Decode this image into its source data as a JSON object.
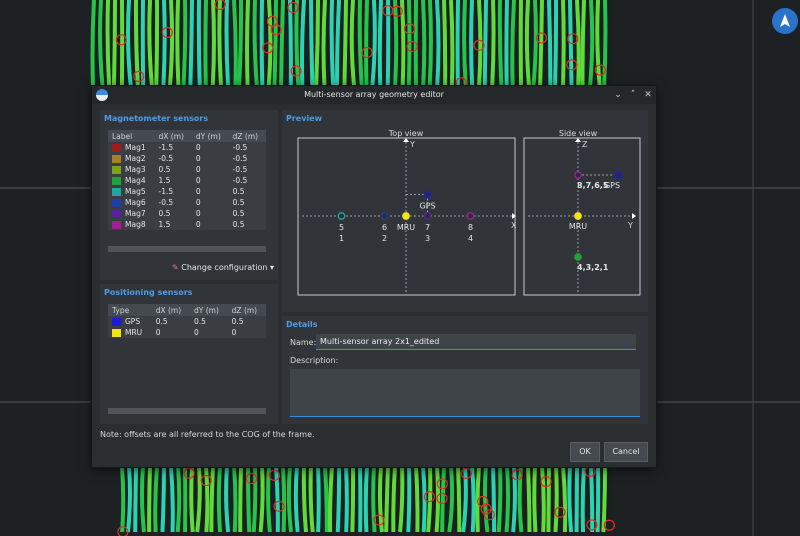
{
  "dialog": {
    "title": "Multi-sensor array geometry editor",
    "controls": [
      "⌄",
      "˄",
      "✕"
    ]
  },
  "magnetometer": {
    "title": "Magnetometer sensors",
    "columns": [
      "Label",
      "dX (m)",
      "dY (m)",
      "dZ (m)"
    ],
    "rows": [
      {
        "label": "Mag1",
        "color": "#a01a1a",
        "dx": "-1.5",
        "dy": "0",
        "dz": "-0.5"
      },
      {
        "label": "Mag2",
        "color": "#a8821e",
        "dx": "-0.5",
        "dy": "0",
        "dz": "-0.5"
      },
      {
        "label": "Mag3",
        "color": "#7ca21e",
        "dx": "0.5",
        "dy": "0",
        "dz": "-0.5"
      },
      {
        "label": "Mag4",
        "color": "#22a03a",
        "dx": "1.5",
        "dy": "0",
        "dz": "-0.5"
      },
      {
        "label": "Mag5",
        "color": "#1fa8a0",
        "dx": "-1.5",
        "dy": "0",
        "dz": "0.5"
      },
      {
        "label": "Mag6",
        "color": "#1f3fa8",
        "dx": "-0.5",
        "dy": "0",
        "dz": "0.5"
      },
      {
        "label": "Mag7",
        "color": "#5a1fa8",
        "dx": "0.5",
        "dy": "0",
        "dz": "0.5"
      },
      {
        "label": "Mag8",
        "color": "#a01f9a",
        "dx": "1.5",
        "dy": "0",
        "dz": "0.5"
      }
    ],
    "change_config": "Change configuration"
  },
  "positioning": {
    "title": "Positioning sensors",
    "columns": [
      "Type",
      "dX (m)",
      "dY (m)",
      "dZ (m)"
    ],
    "rows": [
      {
        "label": "GPS",
        "color": "#1a1ae0",
        "dx": "0.5",
        "dy": "0.5",
        "dz": "0.5"
      },
      {
        "label": "MRU",
        "color": "#f2e21a",
        "dx": "0",
        "dy": "0",
        "dz": "0"
      }
    ]
  },
  "preview": {
    "title": "Preview",
    "top_view": {
      "title": "Top view",
      "x_axis": "X",
      "y_axis": "Y",
      "points": [
        {
          "name": "5",
          "sub": "1",
          "color": "#1fa8a0",
          "x": -1.5,
          "y": 0
        },
        {
          "name": "6",
          "sub": "2",
          "color": "#1f3fa8",
          "x": -0.5,
          "y": 0
        },
        {
          "name": "MRU",
          "sub": "",
          "color": "#f2e21a",
          "x": 0,
          "y": 0
        },
        {
          "name": "7",
          "sub": "3",
          "color": "#5a1fa8",
          "x": 0.5,
          "y": 0
        },
        {
          "name": "8",
          "sub": "4",
          "color": "#a01f9a",
          "x": 1.5,
          "y": 0
        },
        {
          "name": "GPS",
          "sub": "",
          "color": "#1a1ae0",
          "x": 0.5,
          "y": 0.5
        }
      ]
    },
    "side_view": {
      "title": "Side view",
      "z_axis": "Z",
      "y_axis": "Y",
      "points": [
        {
          "name": "MRU",
          "color": "#f2e21a",
          "y": 0,
          "z": 0
        },
        {
          "name": "4,3,2,1",
          "color": "#22a03a",
          "y": 0,
          "z": -0.5
        },
        {
          "name": "8,7,6,5",
          "color": "#a01f9a",
          "y": 0,
          "z": 0.5
        },
        {
          "name": "GPS",
          "color": "#1a1ae0",
          "y": 0.5,
          "z": 0.5
        }
      ]
    }
  },
  "details": {
    "title": "Details",
    "name_label": "Name:",
    "name_value": "Multi-sensor array 2x1_edited",
    "description_label": "Description:",
    "description_value": ""
  },
  "footer": {
    "note": "Note: offsets are all referred to the COG of the frame.",
    "ok": "OK",
    "cancel": "Cancel"
  }
}
